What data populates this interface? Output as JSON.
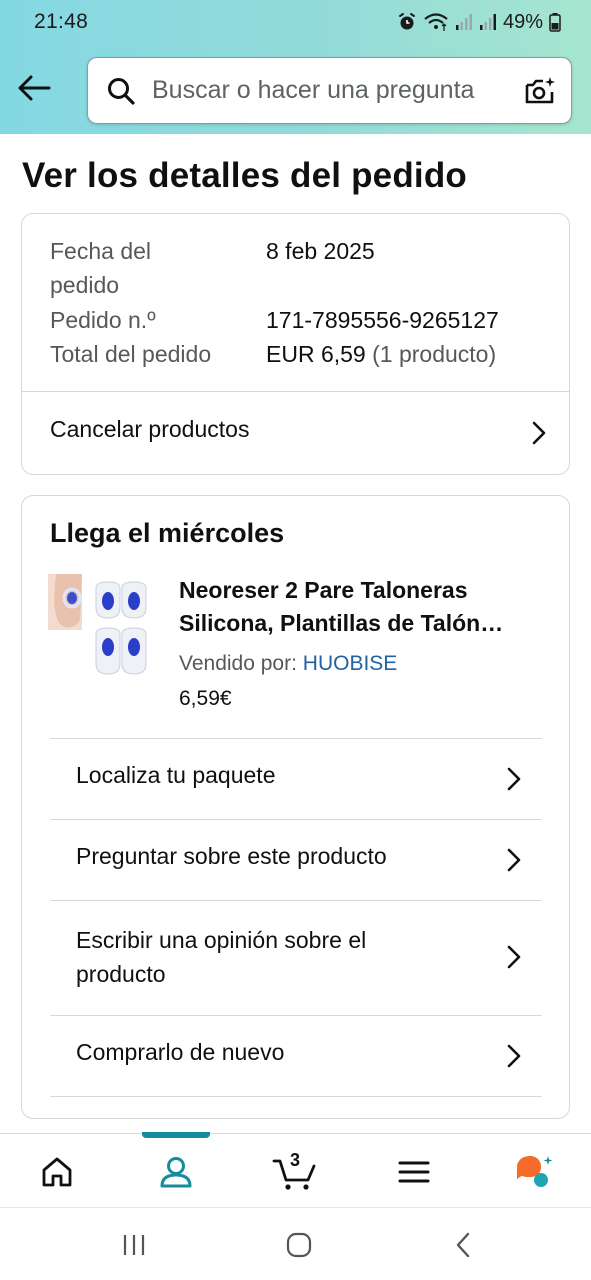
{
  "status_bar": {
    "time": "21:48",
    "battery": "49%"
  },
  "search": {
    "placeholder": "Buscar o hacer una pregunta"
  },
  "page_title": "Ver los detalles del pedido",
  "order": {
    "date_label_line1": "Fecha del",
    "date_label_line2": "pedido",
    "date_value": "8 feb 2025",
    "number_label": "Pedido n.º",
    "number_value": "171-7895556-9265127",
    "total_label": "Total del pedido",
    "total_value": "EUR 6,59",
    "total_count": "(1 producto)",
    "cancel_label": "Cancelar productos"
  },
  "shipment": {
    "arrival": "Llega el miércoles",
    "product_title_line1": "Neoreser 2 Pare Taloneras",
    "product_title_line2": "Silicona, Plantillas de Talón…",
    "sold_by_label": "Vendido por:",
    "seller": "HUOBISE",
    "price": "6,59€",
    "actions": [
      {
        "label": "Localiza tu paquete"
      },
      {
        "label": "Preguntar sobre este producto"
      },
      {
        "label_line1": "Escribir una opinión sobre el",
        "label_line2": "producto"
      },
      {
        "label": "Comprarlo de nuevo"
      }
    ]
  },
  "bottom_nav": {
    "active": "account",
    "cart_count": "3",
    "items": [
      "home-icon",
      "account-icon",
      "cart-icon",
      "menu-icon",
      "rufus-icon"
    ]
  },
  "colors": {
    "header_gradient_start": "#84d8e3",
    "header_gradient_end": "#a6e6cf",
    "accent_teal": "#168b9d",
    "link_blue": "#2162a1",
    "rufus_orange": "#f56b2a"
  }
}
